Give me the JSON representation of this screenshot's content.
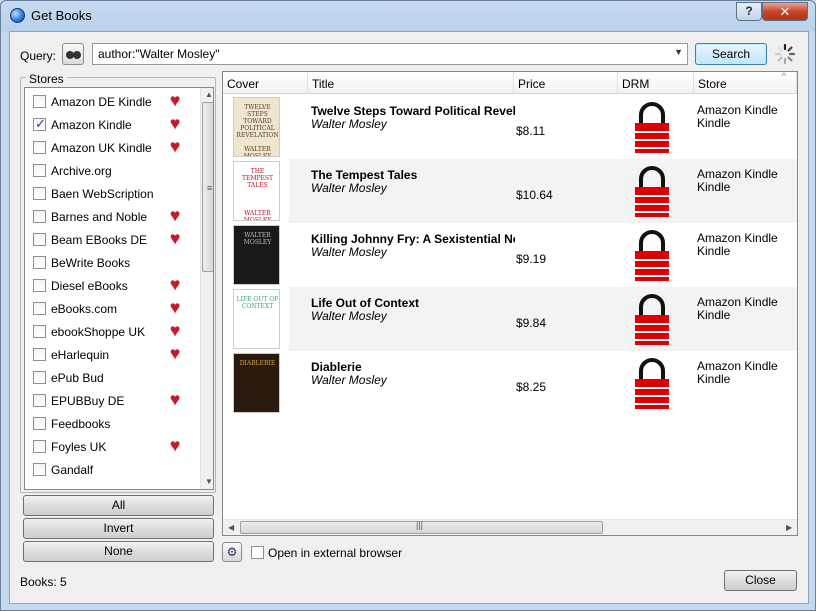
{
  "window": {
    "title": "Get Books",
    "help_label": "?",
    "close_label": "✕"
  },
  "query": {
    "label": "Query:",
    "value": "author:\"Walter Mosley\"",
    "search_label": "Search"
  },
  "stores": {
    "title": "Stores",
    "items": [
      {
        "name": "Amazon DE Kindle",
        "checked": false,
        "heart": true
      },
      {
        "name": "Amazon Kindle",
        "checked": true,
        "heart": true
      },
      {
        "name": "Amazon UK Kindle",
        "checked": false,
        "heart": true
      },
      {
        "name": "Archive.org",
        "checked": false,
        "heart": false
      },
      {
        "name": "Baen WebScription",
        "checked": false,
        "heart": false
      },
      {
        "name": "Barnes and Noble",
        "checked": false,
        "heart": true
      },
      {
        "name": "Beam EBooks DE",
        "checked": false,
        "heart": true
      },
      {
        "name": "BeWrite Books",
        "checked": false,
        "heart": false
      },
      {
        "name": "Diesel eBooks",
        "checked": false,
        "heart": true
      },
      {
        "name": "eBooks.com",
        "checked": false,
        "heart": true
      },
      {
        "name": "ebookShoppe UK",
        "checked": false,
        "heart": true
      },
      {
        "name": "eHarlequin",
        "checked": false,
        "heart": true
      },
      {
        "name": "ePub Bud",
        "checked": false,
        "heart": false
      },
      {
        "name": "EPUBBuy DE",
        "checked": false,
        "heart": true
      },
      {
        "name": "Feedbooks",
        "checked": false,
        "heart": false
      },
      {
        "name": "Foyles UK",
        "checked": false,
        "heart": true
      },
      {
        "name": "Gandalf",
        "checked": false,
        "heart": false
      }
    ]
  },
  "buttons": {
    "all": "All",
    "invert": "Invert",
    "none": "None",
    "close": "Close"
  },
  "columns": [
    "Cover",
    "Title",
    "Price",
    "DRM",
    "Store"
  ],
  "results": [
    {
      "title": "Twelve Steps Toward Political Revelatio",
      "author": "Walter Mosley",
      "price": "$8.11",
      "store": "Amazon Kindle Kindle",
      "cover_bg": "#efe6cf",
      "cover_fg": "#5a3b1e",
      "cover_text": "TWELVE STEPS TOWARD POLITICAL REVELATION",
      "cover_author": "WALTER MOSLEY"
    },
    {
      "title": "The Tempest Tales",
      "author": "Walter Mosley",
      "price": "$10.64",
      "store": "Amazon Kindle Kindle",
      "cover_bg": "#ffffff",
      "cover_fg": "#b3121c",
      "cover_text": "THE TEMPEST TALES",
      "cover_author": "WALTER MOSLEY"
    },
    {
      "title": "Killing Johnny Fry: A Sexistential Nove",
      "author": "Walter Mosley",
      "price": "$9.19",
      "store": "Amazon Kindle Kindle",
      "cover_bg": "#1a1a1a",
      "cover_fg": "#bbbbbb",
      "cover_text": "WALTER MOSLEY",
      "cover_author": ""
    },
    {
      "title": "Life Out of Context",
      "author": "Walter Mosley",
      "price": "$9.84",
      "store": "Amazon Kindle Kindle",
      "cover_bg": "#ffffff",
      "cover_fg": "#3d9a8a",
      "cover_text": "LIFE OUT OF CONTEXT",
      "cover_author": ""
    },
    {
      "title": "Diablerie",
      "author": "Walter Mosley",
      "price": "$8.25",
      "store": "Amazon Kindle Kindle",
      "cover_bg": "#2a1a10",
      "cover_fg": "#e0a33a",
      "cover_text": "DIABLERIE",
      "cover_author": ""
    }
  ],
  "external": {
    "label": "Open in external browser",
    "checked": false
  },
  "footer": {
    "books_label": "Books:  5"
  },
  "colors": {
    "accent": "#3c7fb1",
    "lock_red": "#e00000",
    "heart": "#c8182c"
  }
}
